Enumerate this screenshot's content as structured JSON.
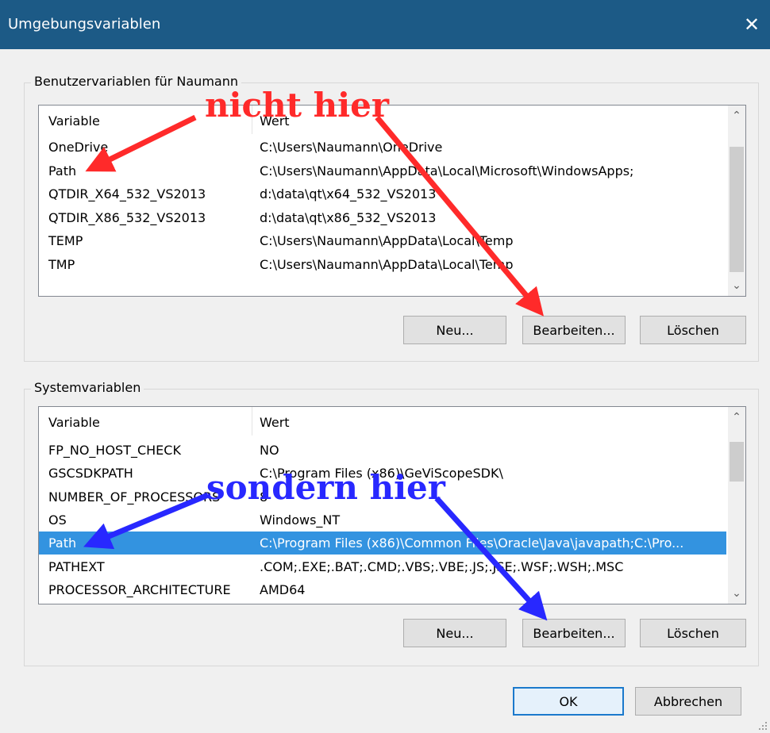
{
  "window": {
    "title": "Umgebungsvariablen",
    "close_glyph": "✕"
  },
  "user_group": {
    "label": "Benutzervariablen für Naumann",
    "columns": {
      "variable": "Variable",
      "value": "Wert"
    },
    "rows": [
      {
        "variable": "OneDrive",
        "value": "C:\\Users\\Naumann\\OneDrive"
      },
      {
        "variable": "Path",
        "value": "C:\\Users\\Naumann\\AppData\\Local\\Microsoft\\WindowsApps;"
      },
      {
        "variable": "QTDIR_X64_532_VS2013",
        "value": "d:\\data\\qt\\x64_532_VS2013"
      },
      {
        "variable": "QTDIR_X86_532_VS2013",
        "value": "d:\\data\\qt\\x86_532_VS2013"
      },
      {
        "variable": "TEMP",
        "value": "C:\\Users\\Naumann\\AppData\\Local\\Temp"
      },
      {
        "variable": "TMP",
        "value": "C:\\Users\\Naumann\\AppData\\Local\\Temp"
      }
    ],
    "buttons": {
      "new": "Neu...",
      "edit": "Bearbeiten...",
      "delete": "Löschen"
    }
  },
  "system_group": {
    "label": "Systemvariablen",
    "columns": {
      "variable": "Variable",
      "value": "Wert"
    },
    "rows": [
      {
        "variable": "FP_NO_HOST_CHECK",
        "value": "NO"
      },
      {
        "variable": "GSCSDKPATH",
        "value": "C:\\Program Files (x86)\\GeViScopeSDK\\"
      },
      {
        "variable": "NUMBER_OF_PROCESSORS",
        "value": "8"
      },
      {
        "variable": "OS",
        "value": "Windows_NT"
      },
      {
        "variable": "Path",
        "value": "C:\\Program Files (x86)\\Common Files\\Oracle\\Java\\javapath;C:\\Pro..."
      },
      {
        "variable": "PATHEXT",
        "value": ".COM;.EXE;.BAT;.CMD;.VBS;.VBE;.JS;.JSE;.WSF;.WSH;.MSC"
      },
      {
        "variable": "PROCESSOR_ARCHITECTURE",
        "value": "AMD64"
      }
    ],
    "selected_row": 4,
    "buttons": {
      "new": "Neu...",
      "edit": "Bearbeiten...",
      "delete": "Löschen"
    }
  },
  "footer": {
    "ok": "OK",
    "cancel": "Abbrechen"
  },
  "annotations": {
    "top": {
      "text": "nicht hier",
      "color": "#ff2a2a"
    },
    "bottom": {
      "text": "sondern hier",
      "color": "#2828ff"
    }
  },
  "colors": {
    "titlebar": "#1c5a86",
    "selection": "#3393e0",
    "default_button_border": "#1b79cc"
  }
}
